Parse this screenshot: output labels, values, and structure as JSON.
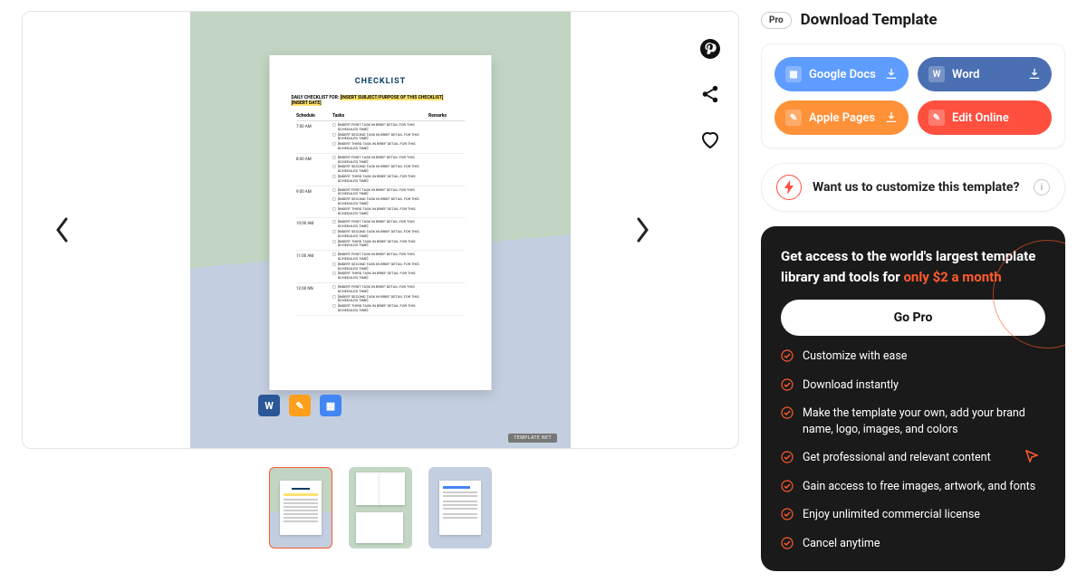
{
  "header": {
    "pro_badge": "Pro",
    "title": "Download Template"
  },
  "buttons": {
    "google_docs": "Google Docs",
    "word": "Word",
    "apple_pages": "Apple Pages",
    "edit_online": "Edit Online"
  },
  "customize": {
    "text": "Want us to customize this template?"
  },
  "promo": {
    "lead": "Get access to the world's largest template library and tools for",
    "highlight": "only $2 a month",
    "cta": "Go Pro",
    "features": [
      "Customize with ease",
      "Download instantly",
      "Make the template your own, add your brand name, logo, images, and colors",
      "Get professional and relevant content",
      "Gain access to free images, artwork, and fonts",
      "Enjoy unlimited commercial license",
      "Cancel anytime"
    ]
  },
  "doc": {
    "title": "CHECKLIST",
    "sub_label": "DAILY CHECKLIST FOR:",
    "sub_hl": "[INSERT SUBJECT/PURPOSE OF THIS CHECKLIST]",
    "date": "[INSERT DATE]",
    "headers": {
      "c1": "Schedule",
      "c2": "Tasks",
      "c3": "Remarks"
    },
    "times": [
      "7:00 AM",
      "8:00 AM",
      "9:00 AM",
      "10:00 AM",
      "11:00 AM",
      "12:00 NN"
    ],
    "task1": "[INSERT FIRST TASK IN BRIEF DETAIL FOR THIS SCHEDULED TIME]",
    "task2": "[INSERT SECOND TASK IN BRIEF DETAIL FOR THIS SCHEDULED TIME]",
    "task3": "[INSERT THIRD TASK IN BRIEF DETAIL FOR THIS SCHEDULED TIME]",
    "watermark": "TEMPLATE.NET"
  }
}
